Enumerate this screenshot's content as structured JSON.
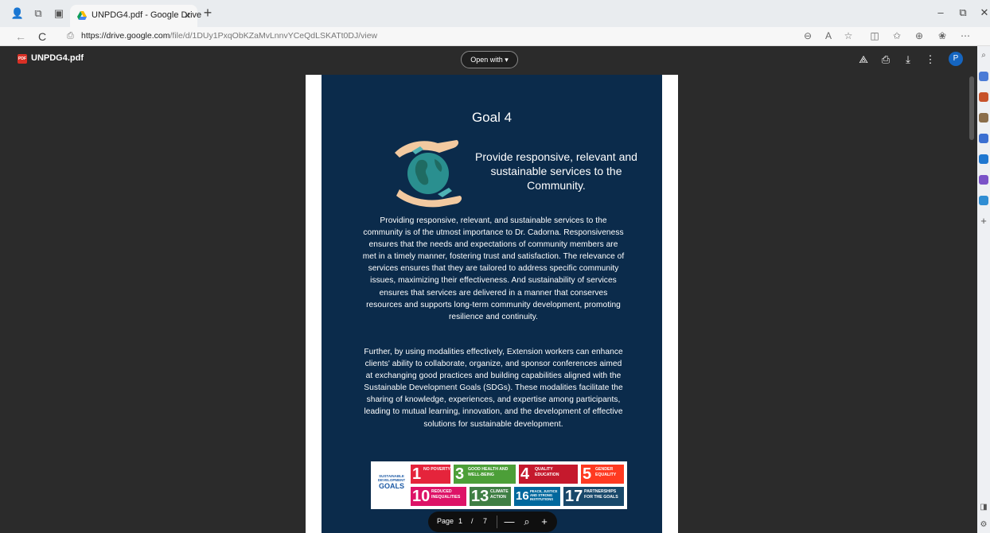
{
  "browser": {
    "tab": {
      "title": "UNPDG4.pdf - Google Drive",
      "close": "×"
    },
    "new_tab": "+",
    "window_controls": {
      "minimize": "–",
      "restore": "⧉",
      "close": "✕"
    },
    "nav": {
      "back": "←",
      "reload": "C"
    },
    "url_host": "https://drive.google.com",
    "url_path": "/file/d/1DUy1PxqObKZaMvLnnvYCeQdLSKATt0DJ/view",
    "address_icons": [
      "zoom-icon",
      "read-aloud-icon",
      "favorite-star-icon",
      "split-screen-icon",
      "favorites-icon",
      "collections-icon",
      "copilot-icon",
      "more-icon"
    ]
  },
  "viewer": {
    "file_badge": "PDF",
    "file_name": "UNPDG4.pdf",
    "open_with": "Open with",
    "avatar_initial": "P",
    "colors": {
      "background": "#2b2b2b",
      "page_bg": "#0b2b4b",
      "avatar": "#1565c0"
    }
  },
  "document": {
    "goal_title": "Goal 4",
    "subtitle": "Provide responsive, relevant and sustainable services to the Community.",
    "paragraph1": "Providing responsive, relevant, and sustainable services to the community is of the utmost importance to Dr. Cadorna. Responsiveness ensures that the needs and expectations of community members are met in a timely manner, fostering trust and satisfaction. The relevance of services ensures that they are tailored to address specific community issues, maximizing their effectiveness. And sustainability of services ensures that services are delivered in a manner that conserves resources and supports long-term community development, promoting resilience and continuity.",
    "paragraph2": "Further, by using modalities effectively, Extension workers can enhance clients' ability to collaborate, organize, and sponsor conferences aimed at exchanging good practices and building capabilities aligned with the Sustainable Development Goals (SDGs). These modalities facilitate the sharing of knowledge, experiences, and expertise among participants, leading to mutual learning, innovation, and the development of effective solutions for sustainable development.",
    "sdg_logo_small": "SUSTAINABLE DEVELOPMENT",
    "sdg_logo_big": "GOALS",
    "sdg_tiles": [
      {
        "num": "1",
        "label": "No Poverty",
        "color": "#e5243b"
      },
      {
        "num": "3",
        "label": "Good Health and Well-Being",
        "color": "#4c9f38"
      },
      {
        "num": "4",
        "label": "Quality Education",
        "color": "#c5192d"
      },
      {
        "num": "5",
        "label": "Gender Equality",
        "color": "#ff3a21"
      },
      {
        "num": "10",
        "label": "Reduced Inequalities",
        "color": "#dd1367"
      },
      {
        "num": "13",
        "label": "Climate Action",
        "color": "#3f7e44"
      },
      {
        "num": "16",
        "label": "Peace, Justice and Strong Institutions",
        "color": "#00689d"
      },
      {
        "num": "17",
        "label": "Partnerships for the Goals",
        "color": "#19486a"
      }
    ]
  },
  "page_toolbar": {
    "label": "Page",
    "current": "1",
    "separator": "/",
    "total": "7",
    "zoom_out": "—",
    "zoom_in": "+"
  }
}
